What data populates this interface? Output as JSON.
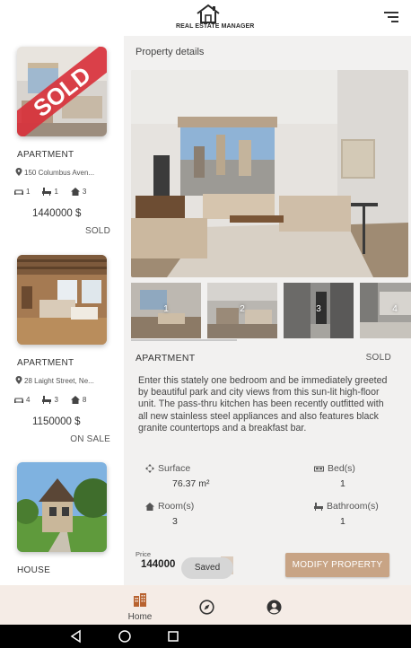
{
  "app": {
    "logo_text": "REAL ESTATE MANAGER"
  },
  "sidebar": {
    "cards": [
      {
        "type": "APARTMENT",
        "address": "150 Columbus Aven...",
        "rooms": "1",
        "bathrooms": "1",
        "bedrooms": "3",
        "price": "1440000 $",
        "status": "SOLD",
        "image_overlay": "SOLD"
      },
      {
        "type": "APARTMENT",
        "address": "28 Laight Street, Ne...",
        "rooms": "4",
        "bathrooms": "3",
        "bedrooms": "8",
        "price": "1150000 $",
        "status": "ON SALE"
      },
      {
        "type": "HOUSE"
      }
    ]
  },
  "detail": {
    "title": "Property details",
    "thumbnails": [
      "1",
      "2",
      "3",
      "4"
    ],
    "type": "APARTMENT",
    "status": "SOLD",
    "description": "Enter this stately one bedroom and be immediately greeted by beautiful park and city views from this sun-lit high-floor unit. The pass-thru kitchen has been recently outfitted with all new stainless steel appliances and also features black granite countertops and a breakfast bar.",
    "surface_label": "Surface",
    "surface_value": "76.37 m²",
    "bedrooms_label": "Bed(s)",
    "bedrooms_value": "1",
    "rooms_label": "Room(s)",
    "rooms_value": "3",
    "bathrooms_label": "Bathroom(s)",
    "bathrooms_value": "1",
    "price_label": "Price",
    "price_value": "144000",
    "toast": "Saved",
    "modify_button": "MODIFY PROPERTY"
  },
  "bottom_nav": {
    "items": [
      {
        "label": "Home",
        "icon": "building-icon"
      },
      {
        "label": "",
        "icon": "compass-icon"
      },
      {
        "label": "",
        "icon": "account-icon"
      }
    ]
  },
  "colors": {
    "accent": "#c8a485",
    "nav_background": "#f5ece6",
    "panel_background": "#f2f1f0",
    "sold_banner": "#d8323c"
  }
}
